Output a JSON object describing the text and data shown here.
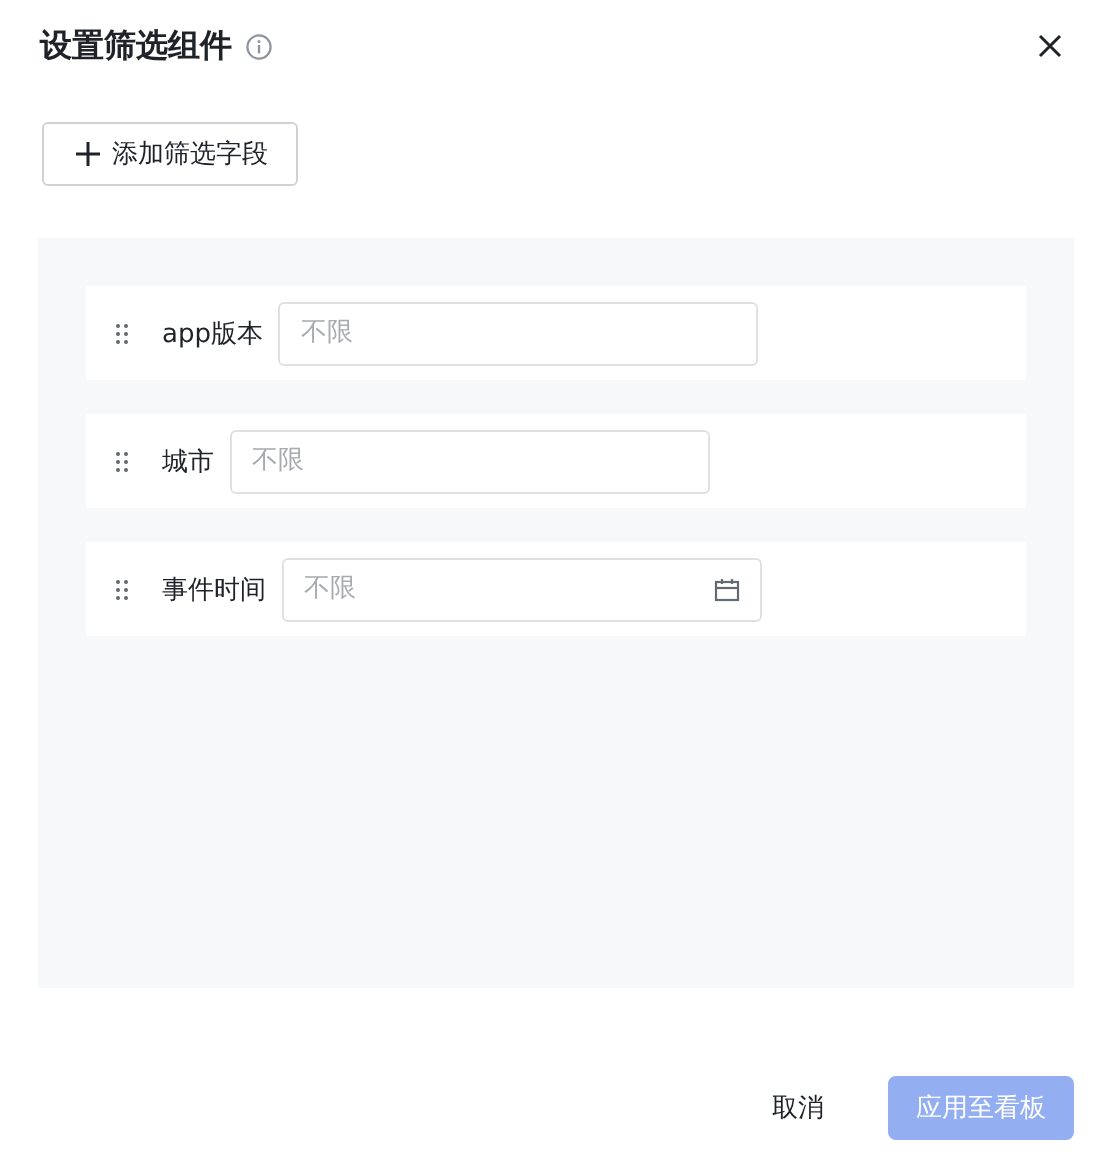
{
  "dialog": {
    "title": "设置筛选组件",
    "add_button": "添加筛选字段"
  },
  "filters": [
    {
      "label": "app版本",
      "kind": "text",
      "placeholder": "不限"
    },
    {
      "label": "城市",
      "kind": "text",
      "placeholder": "不限"
    },
    {
      "label": "事件时间",
      "kind": "date",
      "placeholder": "不限"
    }
  ],
  "footer": {
    "cancel": "取消",
    "confirm": {
      "label": "应用至看板",
      "disabled": true
    }
  }
}
